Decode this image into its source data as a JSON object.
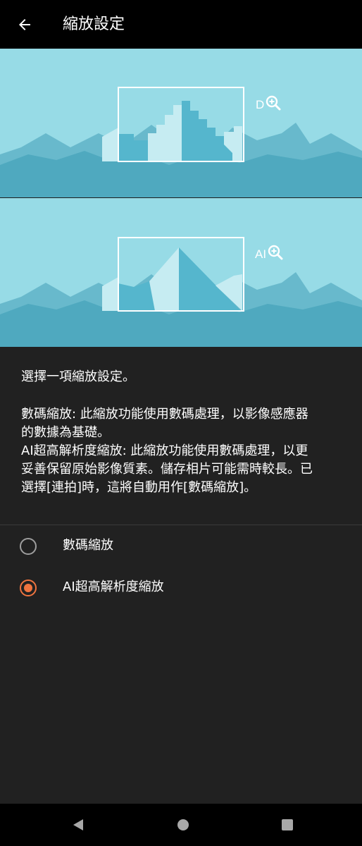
{
  "header": {
    "title": "縮放設定",
    "back_icon": "arrow-left-icon"
  },
  "illustrations": {
    "digital": {
      "badge": "D",
      "icon": "zoom-in-icon"
    },
    "ai": {
      "badge": "AI",
      "icon": "zoom-in-icon"
    },
    "colors": {
      "sky": "#97dbe6",
      "mountain_dark": "#4fa9bf",
      "mountain_mid": "#55b6cd",
      "peak_light": "#c6ecf2",
      "frame": "#ffffff"
    }
  },
  "description": {
    "intro": "選擇一項縮放設定。",
    "lines": [
      "數碼縮放: 此縮放功能使用數碼處理，以影像感應器",
      "的數據為基礎。",
      "AI超高解析度縮放: 此縮放功能使用數碼處理，以更",
      "妥善保留原始影像質素。儲存相片可能需時較長。已",
      "選擇[連拍]時，這將自動用作[數碼縮放]。"
    ]
  },
  "options": [
    {
      "label": "數碼縮放",
      "selected": false
    },
    {
      "label": "AI超高解析度縮放",
      "selected": true
    }
  ],
  "accent_color": "#f0743f",
  "nav": {
    "back_icon": "triangle-back-icon",
    "home_icon": "circle-home-icon",
    "recents_icon": "square-recents-icon"
  }
}
